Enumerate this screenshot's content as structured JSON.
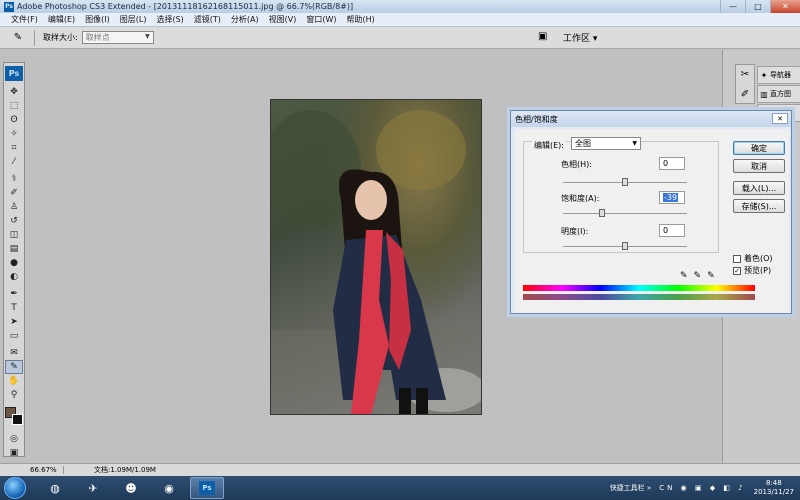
{
  "window": {
    "title": "Adobe Photoshop CS3 Extended - [20131118162168115011.jpg @ 66.7%(RGB/8#)]",
    "app_logo": "Ps",
    "controls": [
      "—",
      "□",
      "✕"
    ]
  },
  "menu": [
    "文件(F)",
    "编辑(E)",
    "图像(I)",
    "图层(L)",
    "选择(S)",
    "滤镜(T)",
    "分析(A)",
    "视图(V)",
    "窗口(W)",
    "帮助(H)"
  ],
  "options": {
    "tool_icon": "eyedropper-icon",
    "sample_size_label": "取样大小:",
    "sample_size_value": "取样点",
    "workspace_label": "工作区 ▾"
  },
  "toolbox": {
    "logo": "Ps",
    "foreground_color": "#6a5642",
    "background_color": "#111111"
  },
  "dock": {
    "items": [
      {
        "label": "导航器",
        "icon": "navigator-icon"
      },
      {
        "label": "直方图",
        "icon": "histogram-icon"
      },
      {
        "label": "信息",
        "icon": "info-icon"
      }
    ]
  },
  "dialog": {
    "title": "色相/饱和度",
    "edit_label": "编辑(E):",
    "edit_value": "全图",
    "hue_label": "色相(H):",
    "hue_value": "0",
    "saturation_label": "饱和度(A):",
    "saturation_value": "-39",
    "lightness_label": "明度(I):",
    "lightness_value": "0",
    "ok_label": "确定",
    "cancel_label": "取消",
    "load_label": "载入(L)...",
    "save_label": "存储(S)...",
    "colorize_label": "着色(O)",
    "colorize_checked": false,
    "preview_label": "预览(P)",
    "preview_checked": true
  },
  "status": {
    "zoom": "66.67%",
    "doc": "文档:1.09M/1.09M"
  },
  "taskbar": {
    "quick_launch": "快捷工具栏 »",
    "tray_icons": "CN ◉ ▣ ◆ ◧ ♪",
    "time": "8:48",
    "date": "2013/11/27"
  }
}
